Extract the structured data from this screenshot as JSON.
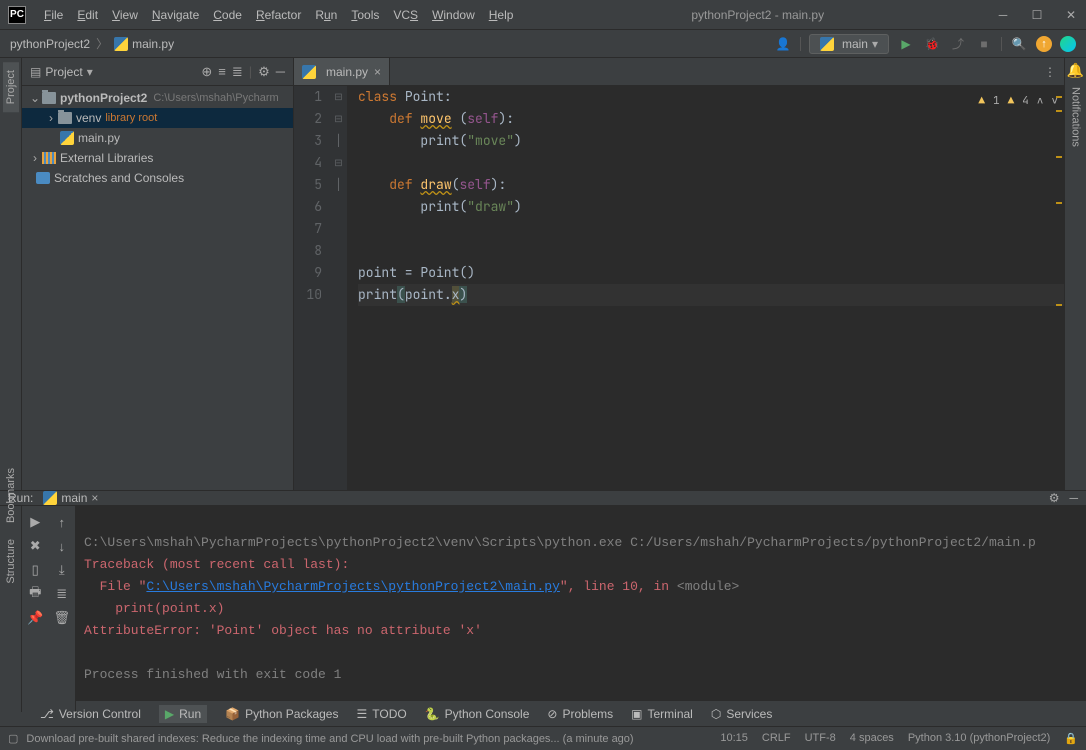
{
  "window": {
    "title": "pythonProject2 - main.py"
  },
  "menu": [
    "File",
    "Edit",
    "View",
    "Navigate",
    "Code",
    "Refactor",
    "Run",
    "Tools",
    "VCS",
    "Window",
    "Help"
  ],
  "breadcrumb": {
    "project": "pythonProject2",
    "file": "main.py"
  },
  "runConfig": {
    "name": "main"
  },
  "projectPanel": {
    "title": "Project",
    "root": {
      "name": "pythonProject2",
      "path": "C:\\Users\\mshah\\Pycharm"
    },
    "venv": {
      "name": "venv",
      "tag": "library root"
    },
    "file": "main.py",
    "extLib": "External Libraries",
    "scratch": "Scratches and Consoles"
  },
  "tabs": [
    {
      "name": "main.py"
    }
  ],
  "warnings": {
    "a": "1",
    "b": "4"
  },
  "code": {
    "lines": [
      "1",
      "2",
      "3",
      "4",
      "5",
      "6",
      "7",
      "8",
      "9",
      "10"
    ],
    "l1": {
      "kw": "class",
      "name": " Point:"
    },
    "l2": {
      "kw": "def",
      "fn": "move",
      "self": "self"
    },
    "l3": {
      "fn": "print",
      "str": "\"move\""
    },
    "l5": {
      "kw": "def",
      "fn": "draw",
      "self": "self"
    },
    "l6": {
      "fn": "print",
      "str": "\"draw\""
    },
    "l9": {
      "var": "point = Point()"
    },
    "l10": {
      "fn": "print",
      "arg": "point.",
      "x": "x"
    }
  },
  "run": {
    "label": "Run:",
    "tab": "main",
    "cmd": "C:\\Users\\mshah\\PycharmProjects\\pythonProject2\\venv\\Scripts\\python.exe C:/Users/mshah/PycharmProjects/pythonProject2/main.p",
    "trace": "Traceback (most recent call last):",
    "fileLine1": "  File \"",
    "fileLink": "C:\\Users\\mshah\\PycharmProjects\\pythonProject2\\main.py",
    "fileLine2": "\", line 10, in ",
    "module": "<module>",
    "printLine": "    print(point.x)",
    "err": "AttributeError: 'Point' object has no attribute 'x'",
    "exit": "Process finished with exit code 1"
  },
  "bottomBar": {
    "vc": "Version Control",
    "run": "Run",
    "pkg": "Python Packages",
    "todo": "TODO",
    "console": "Python Console",
    "problems": "Problems",
    "terminal": "Terminal",
    "services": "Services"
  },
  "statusBar": {
    "msg": "Download pre-built shared indexes: Reduce the indexing time and CPU load with pre-built Python packages... (a minute ago)",
    "pos": "10:15",
    "eol": "CRLF",
    "enc": "UTF-8",
    "indent": "4 spaces",
    "interp": "Python 3.10 (pythonProject2)"
  },
  "sideTabs": {
    "project": "Project",
    "bookmarks": "Bookmarks",
    "structure": "Structure",
    "notifications": "Notifications"
  }
}
